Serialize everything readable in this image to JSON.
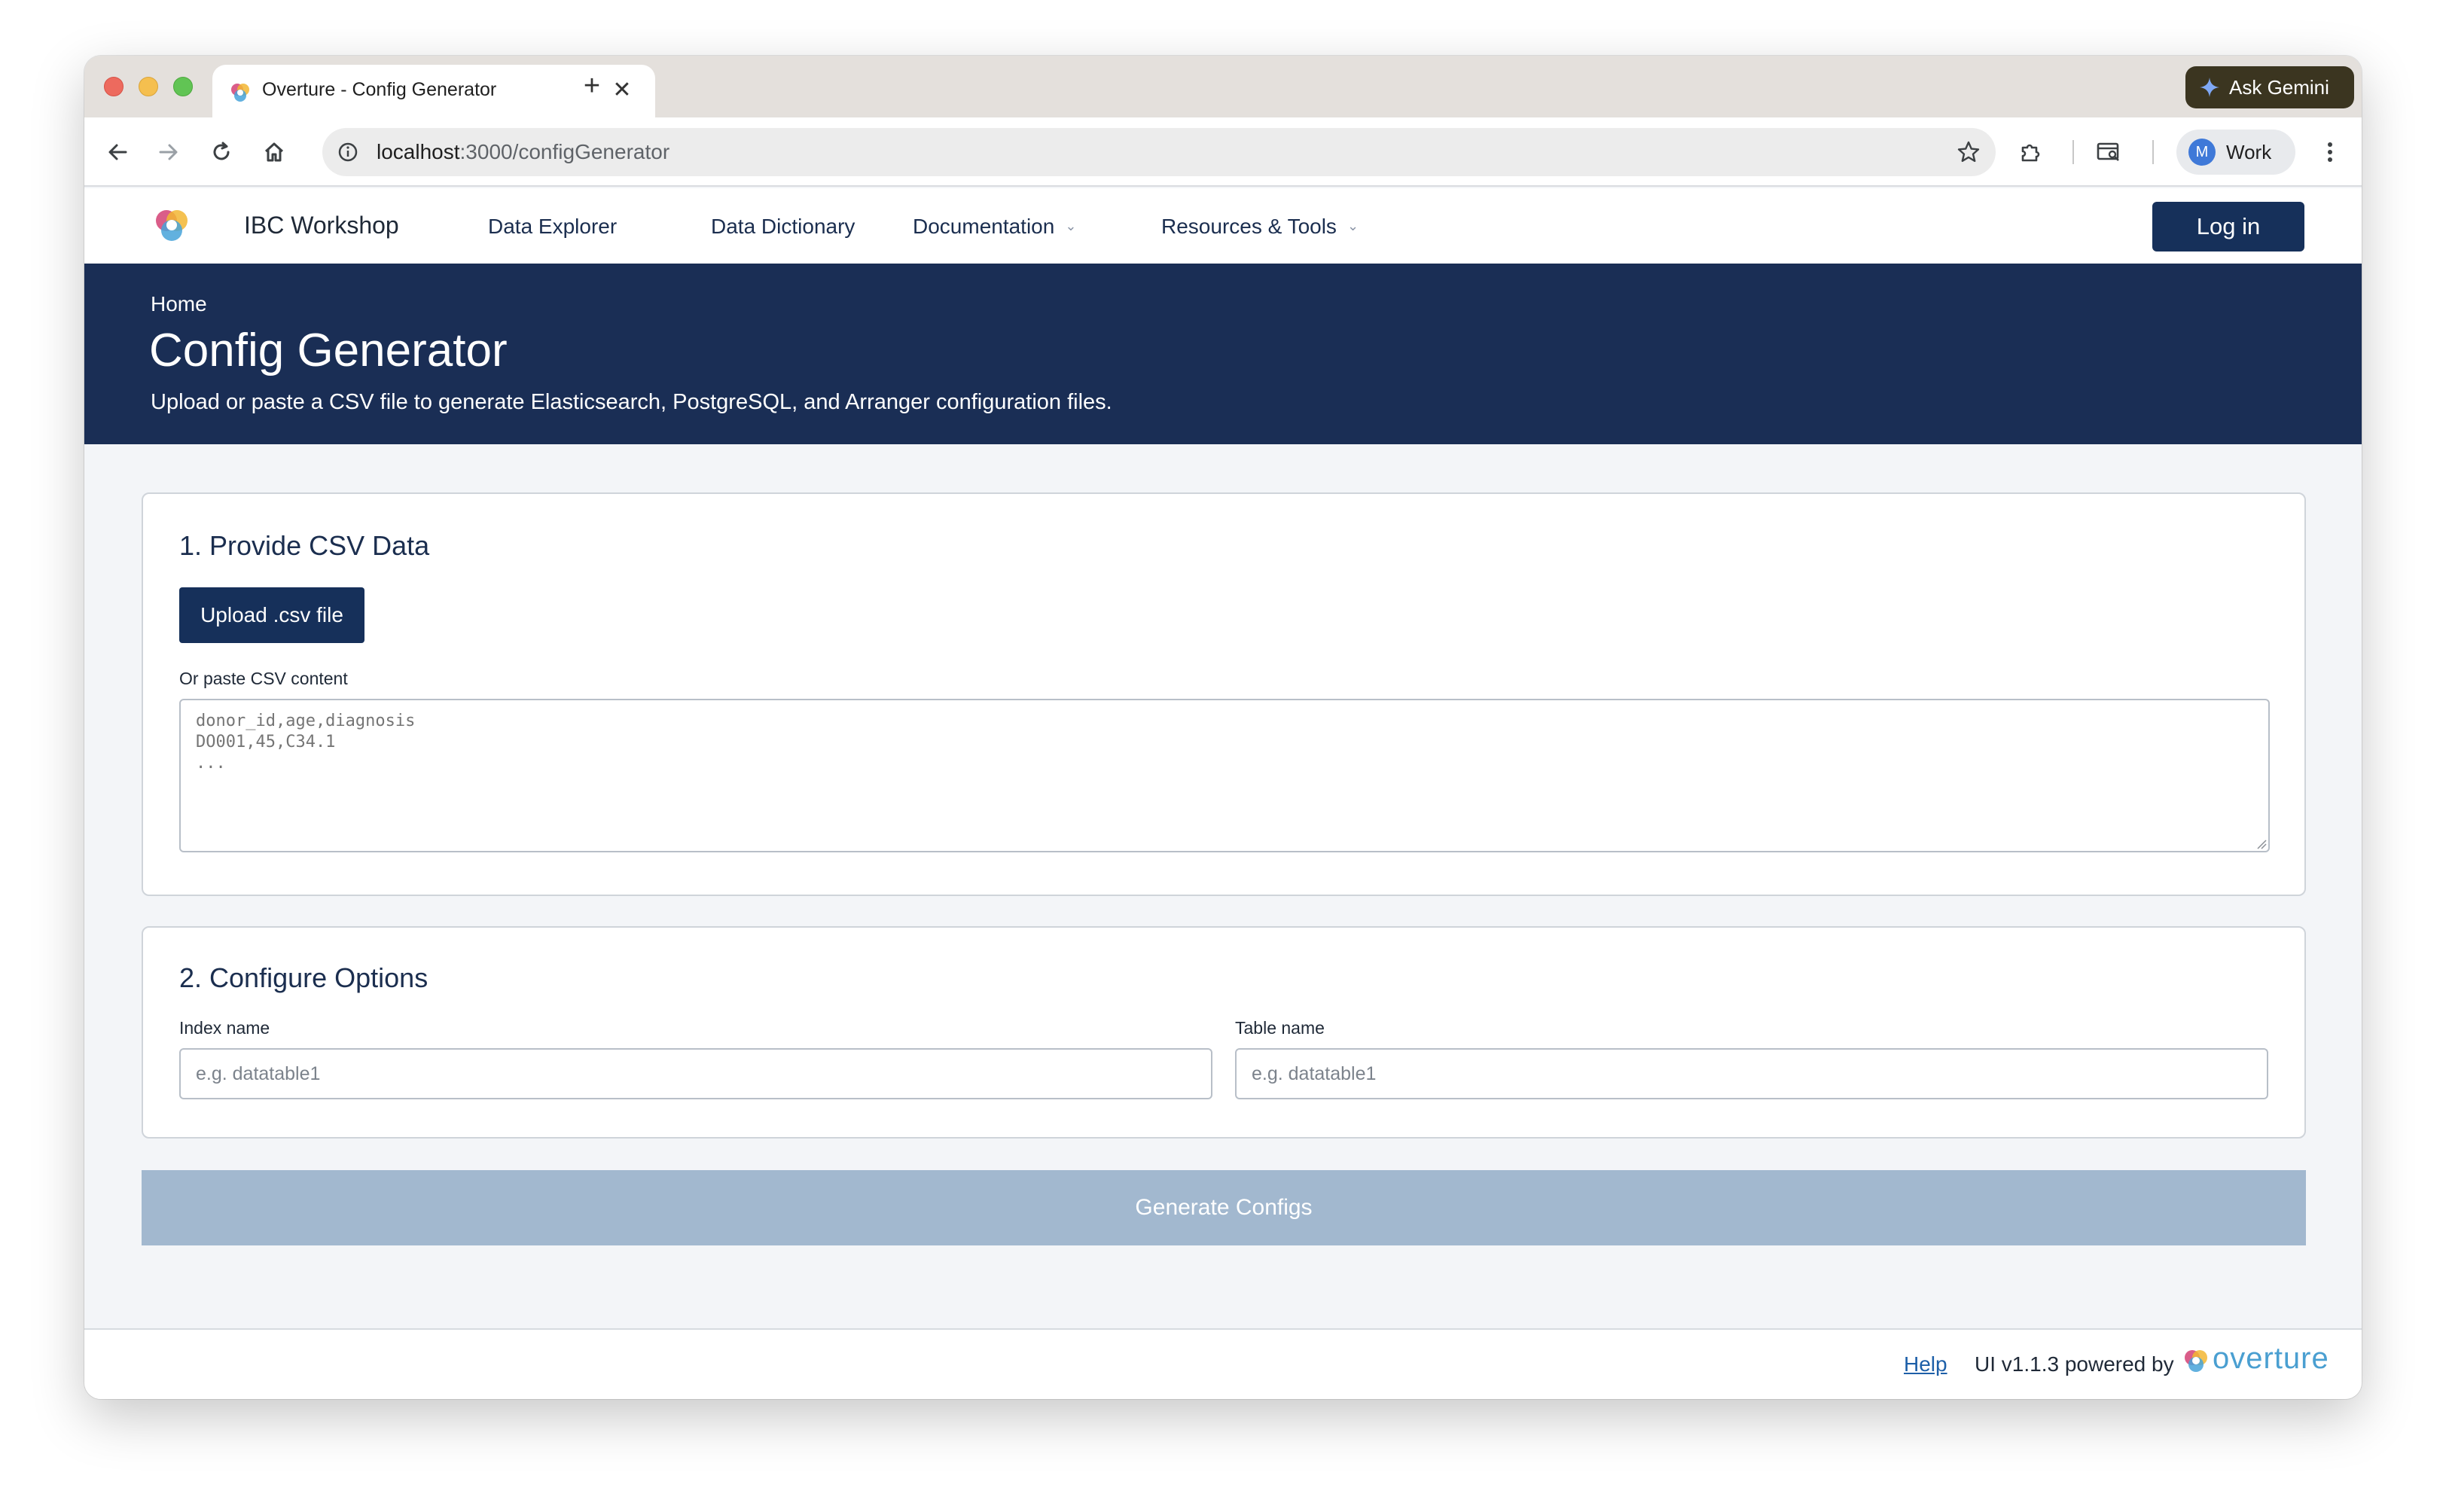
{
  "browser": {
    "tab_title": "Overture - Config Generator",
    "tab_close_glyph": "✕",
    "new_tab_glyph": "+",
    "gemini_label": "Ask Gemini",
    "url_host": "localhost",
    "url_path": ":3000/configGenerator",
    "profile_initial": "M",
    "profile_label": "Work",
    "icons": [
      "back-arrow-icon",
      "forward-arrow-icon",
      "reload-icon",
      "home-icon",
      "site-info-icon",
      "bookmark-star-icon",
      "extensions-icon",
      "tab-search-icon",
      "more-menu-icon"
    ]
  },
  "nav": {
    "site_name": "IBC Workshop",
    "links": [
      "Data Explorer",
      "Data Dictionary",
      "Documentation",
      "Resources & Tools"
    ],
    "dropdown_caret": "⌄",
    "login_label": "Log in"
  },
  "hero": {
    "breadcrumb": "Home",
    "title": "Config Generator",
    "subtitle": "Upload or paste a CSV file to generate Elasticsearch, PostgreSQL, and Arranger configuration files."
  },
  "step1": {
    "title": "1. Provide CSV Data",
    "upload_label": "Upload .csv file",
    "paste_label": "Or paste CSV content",
    "paste_placeholder": "donor_id,age,diagnosis\nDO001,45,C34.1\n..."
  },
  "step2": {
    "title": "2. Configure Options",
    "index_label": "Index name",
    "index_placeholder": "e.g. datatable1",
    "table_label": "Table name",
    "table_placeholder": "e.g. datatable1"
  },
  "generate_label": "Generate Configs",
  "footer": {
    "help": "Help",
    "version": "UI v1.1.3 powered by",
    "brand": "overture"
  },
  "colors": {
    "brand_navy": "#1a2e55",
    "button_navy": "#16305a",
    "disabled_button": "#a2b8cf",
    "link_blue": "#1d5fa8",
    "overture_blue": "#4a9fd1"
  }
}
